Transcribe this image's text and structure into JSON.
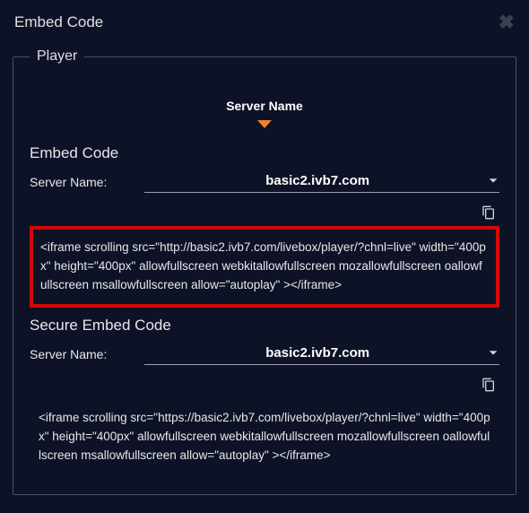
{
  "modal": {
    "title": "Embed Code"
  },
  "fieldset": {
    "legend": "Player"
  },
  "tab": {
    "label": "Server Name"
  },
  "embed": {
    "title": "Embed Code",
    "server_label": "Server Name:",
    "server_value": "basic2.ivb7.com",
    "code": "<iframe scrolling src=\"http://basic2.ivb7.com/livebox/player/?chnl=live\" width=\"400px\" height=\"400px\" allowfullscreen webkitallowfullscreen mozallowfullscreen oallowfullscreen msallowfullscreen allow=\"autoplay\" ></iframe>"
  },
  "secure": {
    "title": "Secure Embed Code",
    "server_label": "Server Name:",
    "server_value": "basic2.ivb7.com",
    "code": "<iframe scrolling src=\"https://basic2.ivb7.com/livebox/player/?chnl=live\" width=\"400px\" height=\"400px\" allowfullscreen webkitallowfullscreen mozallowfullscreen oallowfullscreen msallowfullscreen allow=\"autoplay\" ></iframe>"
  },
  "icons": {
    "copy": "copy-icon",
    "close": "close-icon",
    "dropdown": "chevron-down-icon"
  }
}
